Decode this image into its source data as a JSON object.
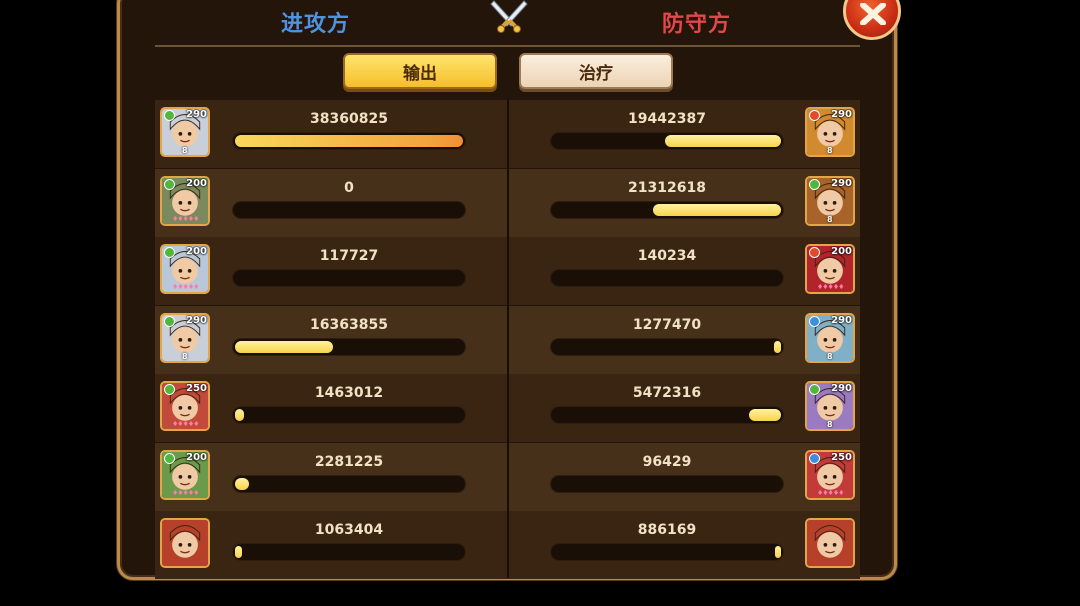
{
  "header": {
    "attacker_label": "进攻方",
    "defender_label": "防守方"
  },
  "tabs": [
    {
      "label": "输出",
      "active": true
    },
    {
      "label": "治疗",
      "active": false
    }
  ],
  "colors": {
    "attacker": "#4f93e0",
    "defender": "#e2474a",
    "bar_fill": "#f7d34a"
  },
  "attackers": [
    {
      "value": "38360825",
      "level": "290",
      "stars": "8",
      "element": "nature",
      "fill": 1.0
    },
    {
      "value": "0",
      "level": "200",
      "stars": "",
      "element": "nature",
      "fill": 0.0
    },
    {
      "value": "117727",
      "level": "200",
      "stars": "",
      "element": "nature",
      "fill": 0.0
    },
    {
      "value": "16363855",
      "level": "290",
      "stars": "8",
      "element": "nature",
      "fill": 0.43
    },
    {
      "value": "1463012",
      "level": "250",
      "stars": "",
      "element": "nature",
      "fill": 0.04
    },
    {
      "value": "2281225",
      "level": "200",
      "stars": "",
      "element": "nature",
      "fill": 0.06
    },
    {
      "value": "1063404",
      "level": "",
      "stars": "",
      "element": "",
      "fill": 0.03
    }
  ],
  "defenders": [
    {
      "value": "19442387",
      "level": "290",
      "stars": "8",
      "element": "fire",
      "fill": 0.51
    },
    {
      "value": "21312618",
      "level": "290",
      "stars": "8",
      "element": "nature",
      "fill": 0.56
    },
    {
      "value": "140234",
      "level": "200",
      "stars": "",
      "element": "fire",
      "fill": 0.0
    },
    {
      "value": "1277470",
      "level": "290",
      "stars": "8",
      "element": "water",
      "fill": 0.03
    },
    {
      "value": "5472316",
      "level": "290",
      "stars": "8",
      "element": "nature",
      "fill": 0.14
    },
    {
      "value": "96429",
      "level": "250",
      "stars": "",
      "element": "water",
      "fill": 0.0
    },
    {
      "value": "886169",
      "level": "",
      "stars": "",
      "element": "",
      "fill": 0.02
    }
  ]
}
